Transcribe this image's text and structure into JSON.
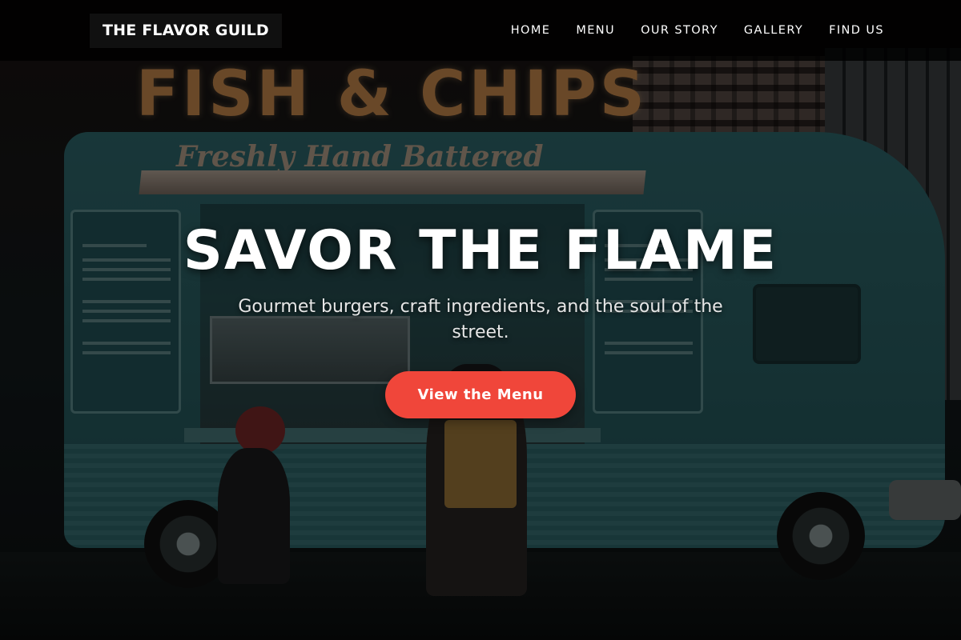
{
  "header": {
    "brand": "THE FLAVOR GUILD",
    "nav": [
      {
        "label": "HOME"
      },
      {
        "label": "MENU"
      },
      {
        "label": "OUR STORY"
      },
      {
        "label": "GALLERY"
      },
      {
        "label": "FIND US"
      }
    ]
  },
  "hero": {
    "title": "SAVOR THE FLAME",
    "subtitle": "Gourmet burgers, craft ingredients, and the soul of the street.",
    "cta_label": "View the Menu",
    "background": {
      "sign_text": "FISH & CHIPS",
      "script_text": "Freshly Hand Battered"
    }
  },
  "colors": {
    "accent": "#f0463a",
    "header_bg": "#000000",
    "text": "#ffffff"
  }
}
